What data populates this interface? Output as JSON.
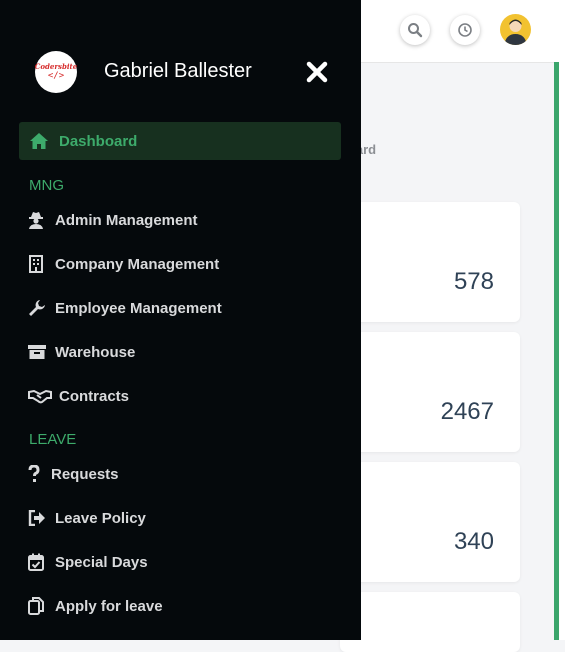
{
  "header": {
    "icons": [
      "search-icon",
      "history-icon",
      "avatar"
    ]
  },
  "breadcrumb": {
    "text": "board"
  },
  "cards": [
    {
      "value": "578"
    },
    {
      "value": "2467"
    },
    {
      "value": "340"
    }
  ],
  "sidebar": {
    "logo": {
      "name": "Codersbite",
      "code": "</>"
    },
    "user_name": "Gabriel Ballester",
    "active_item": {
      "label": "Dashboard",
      "icon": "home-icon"
    },
    "sections": [
      {
        "title": "MNG",
        "items": [
          {
            "label": "Admin Management",
            "icon": "user-secret-icon"
          },
          {
            "label": "Company Management",
            "icon": "building-icon"
          },
          {
            "label": "Employee Management",
            "icon": "wrench-icon"
          },
          {
            "label": "Warehouse",
            "icon": "archive-icon"
          },
          {
            "label": "Contracts",
            "icon": "handshake-icon"
          }
        ]
      },
      {
        "title": "LEAVE",
        "items": [
          {
            "label": "Requests",
            "icon": "question-icon"
          },
          {
            "label": "Leave Policy",
            "icon": "sign-out-icon"
          },
          {
            "label": "Special Days",
            "icon": "calendar-check-icon"
          },
          {
            "label": "Apply for leave",
            "icon": "copy-icon"
          }
        ]
      }
    ]
  },
  "colors": {
    "accent": "#3dab6b",
    "sidebar_bg": "#05090c",
    "active_bg": "#17301f"
  }
}
